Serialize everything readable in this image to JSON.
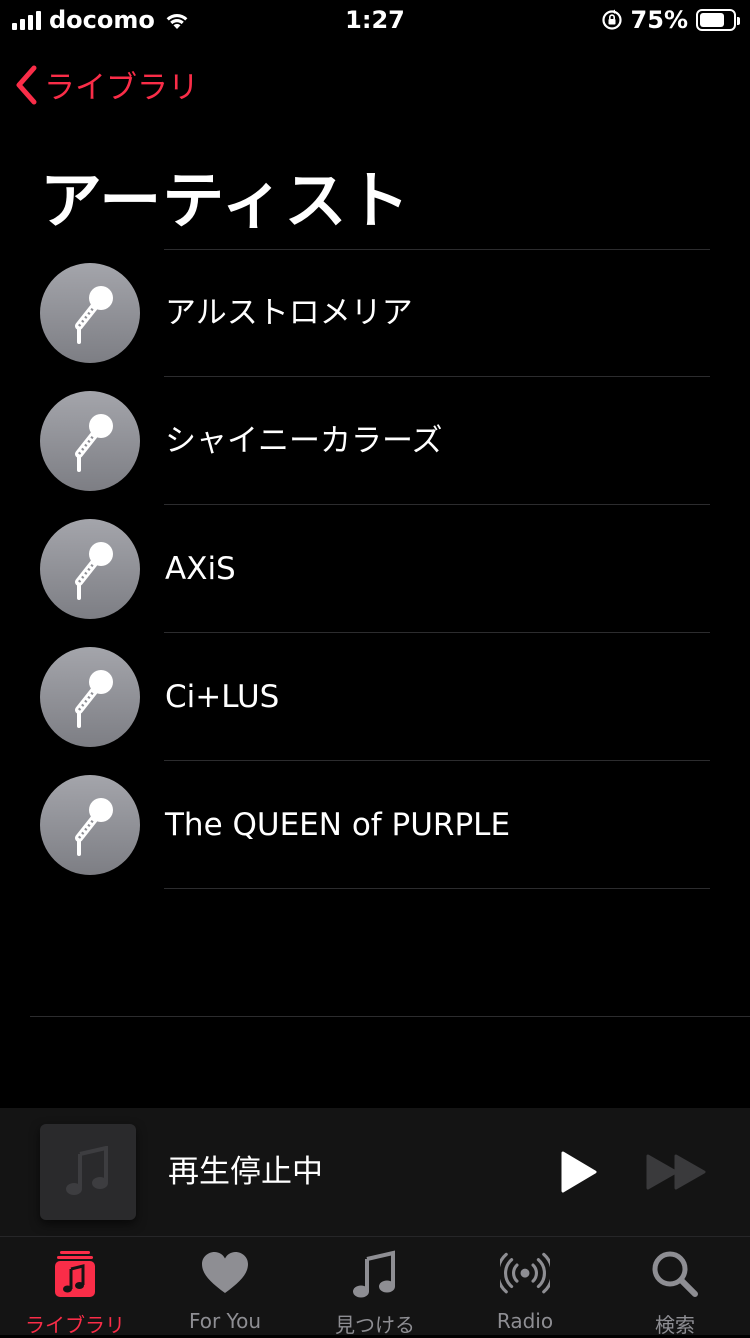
{
  "status_bar": {
    "carrier": "docomo",
    "time": "1:27",
    "battery_percent": "75%",
    "battery_level": 0.75,
    "signal_bars": 4
  },
  "nav": {
    "back_label": "ライブラリ",
    "title": "アーティスト"
  },
  "artists": [
    {
      "name": "アルストロメリア"
    },
    {
      "name": "シャイニーカラーズ"
    },
    {
      "name": "AXiS"
    },
    {
      "name": "Ci+LUS"
    },
    {
      "name": "The QUEEN of PURPLE"
    }
  ],
  "mini_player": {
    "title": "再生停止中",
    "artwork_icon": "music-note-icon",
    "play_icon": "play-icon",
    "forward_icon": "fast-forward-icon"
  },
  "tab_bar": {
    "tabs": [
      {
        "label": "ライブラリ",
        "icon": "library-icon",
        "active": true
      },
      {
        "label": "For You",
        "icon": "heart-icon",
        "active": false
      },
      {
        "label": "見つける",
        "icon": "music-note-icon",
        "active": false
      },
      {
        "label": "Radio",
        "icon": "radio-broadcast-icon",
        "active": false
      },
      {
        "label": "検索",
        "icon": "search-icon",
        "active": false
      }
    ]
  },
  "colors": {
    "accent": "#fa2d48",
    "background": "#000000",
    "inactive_tab": "#8e8e93",
    "avatar": "#8e8f95"
  }
}
